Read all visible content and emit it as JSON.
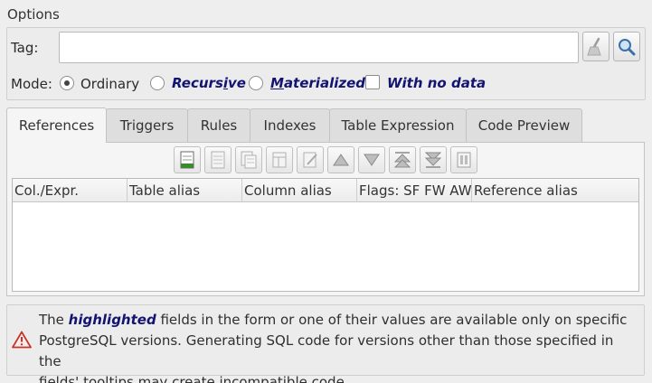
{
  "options": {
    "title": "Options",
    "tag_label": "Tag:",
    "tag_value": "",
    "mode_label": "Mode:",
    "modes": [
      {
        "label": "Ordinary",
        "selected": true
      },
      {
        "label": "Recursive",
        "selected": false,
        "mnemonic_index": 6
      },
      {
        "label": "Materialized",
        "selected": false,
        "mnemonic_index": 0
      }
    ],
    "with_no_data_label": "With no data",
    "with_no_data_checked": false
  },
  "tabs": [
    {
      "label": "References",
      "active": true
    },
    {
      "label": "Triggers",
      "active": false
    },
    {
      "label": "Rules",
      "active": false
    },
    {
      "label": "Indexes",
      "active": false
    },
    {
      "label": "Table Expression",
      "active": false
    },
    {
      "label": "Code Preview",
      "active": false
    }
  ],
  "table": {
    "columns": [
      "Col./Expr.",
      "Table alias",
      "Column alias",
      "Flags: SF FW AW I",
      "Reference alias"
    ],
    "rows": []
  },
  "alert": {
    "prefix": "The ",
    "highlight": "highlighted",
    "line1_rest": " fields in the form or one of their values are available only on specific",
    "line2": "PostgreSQL versions. Generating SQL code for versions other than those specified in the",
    "line3": "fields' tooltips may create incompatible code."
  },
  "colors": {
    "highlight": "#131370",
    "alert_icon": "#c0392b",
    "add_icon": "#3a8a2e"
  }
}
